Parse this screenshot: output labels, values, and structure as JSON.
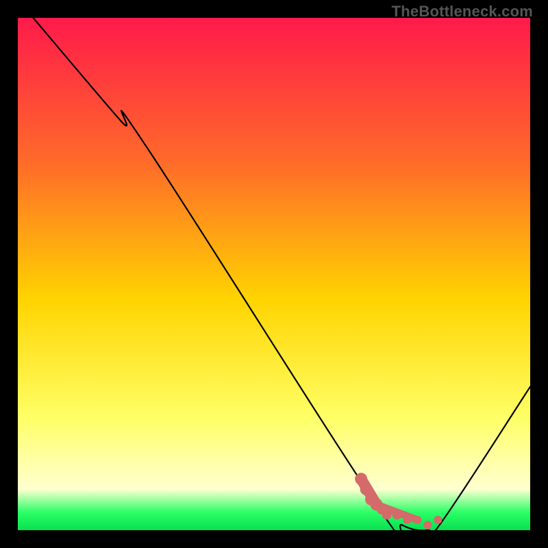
{
  "watermark": "TheBottleneck.com",
  "chart_data": {
    "type": "line",
    "title": "",
    "xlabel": "",
    "ylabel": "",
    "xlim": [
      0,
      100
    ],
    "ylim": [
      0,
      100
    ],
    "grid": false,
    "legend": false,
    "gradient_stops": [
      {
        "offset": 0.0,
        "color": "#ff1a4a"
      },
      {
        "offset": 0.28,
        "color": "#ff6a2a"
      },
      {
        "offset": 0.55,
        "color": "#ffd400"
      },
      {
        "offset": 0.78,
        "color": "#ffff66"
      },
      {
        "offset": 0.92,
        "color": "#ffffd0"
      },
      {
        "offset": 0.965,
        "color": "#2bff66"
      },
      {
        "offset": 1.0,
        "color": "#08e050"
      }
    ],
    "series": [
      {
        "name": "bottleneck-curve",
        "color": "#000000",
        "x": [
          3,
          20,
          25,
          70,
          75,
          80,
          83,
          100
        ],
        "y": [
          100,
          80,
          75,
          5,
          1,
          0,
          2,
          28
        ]
      }
    ],
    "overlay_points": {
      "name": "highlighted-region",
      "color": "#d46a6a",
      "points": [
        {
          "x": 67,
          "y": 10
        },
        {
          "x": 68,
          "y": 8
        },
        {
          "x": 69,
          "y": 6
        },
        {
          "x": 70,
          "y": 5
        },
        {
          "x": 71,
          "y": 4
        },
        {
          "x": 72,
          "y": 3
        },
        {
          "x": 74,
          "y": 3
        },
        {
          "x": 76,
          "y": 2
        },
        {
          "x": 78,
          "y": 2
        },
        {
          "x": 80,
          "y": 1
        },
        {
          "x": 82,
          "y": 2
        }
      ]
    }
  }
}
